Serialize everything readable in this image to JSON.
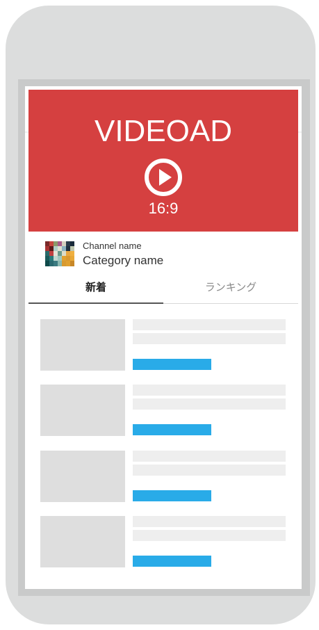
{
  "video_ad": {
    "title": "VIDEOAD",
    "ratio": "16:9",
    "background_color": "#d54040",
    "icon": "play-circle-icon"
  },
  "channel": {
    "name": "Channel name",
    "category": "Category name",
    "avatar": "mosaic-avatar"
  },
  "tabs": [
    {
      "label": "新着",
      "selected": true
    },
    {
      "label": "ランキング",
      "selected": false
    }
  ],
  "colors": {
    "accent": "#29abe8",
    "ad": "#d54040",
    "placeholder": "#dedede",
    "phone_body": "#dcdddd"
  },
  "list": {
    "item_count": 4
  }
}
